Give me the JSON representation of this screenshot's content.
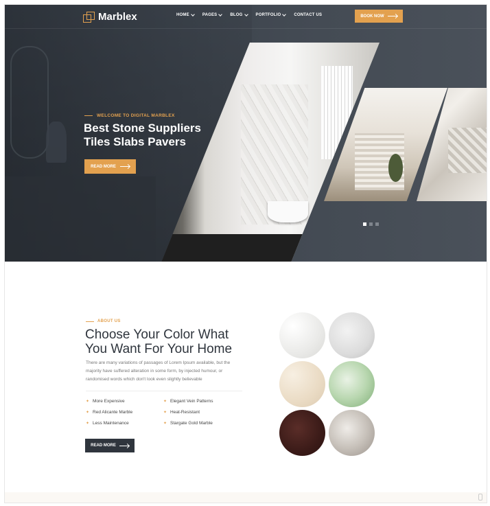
{
  "brand": {
    "name": "Marblex",
    "accent": "#e3a14f",
    "dark": "#2f353d"
  },
  "nav": {
    "items": [
      "HOME",
      "PAGES",
      "BLOG",
      "PORTFOLIO",
      "CONTACT US"
    ],
    "book_label": "BOOK NOW"
  },
  "hero": {
    "kicker": "WELCOME TO DIGITAL MARBLEX",
    "title_line1": "Best Stone Suppliers",
    "title_line2": "Tiles Slabs Pavers",
    "button_label": "READ MORE",
    "slider": {
      "count": 3,
      "active": 1
    }
  },
  "about": {
    "kicker": "ABOUT US",
    "title_line1": "Choose Your Color What",
    "title_line2": "You Want For Your Home",
    "text": "There are many variations of passages of Lorem Ipsum available, but the majority have suffered alteration in some form, by injected humour, or randomised words which don't look even slightly believable",
    "features": [
      "More Expensive",
      "Elegant Vein Patterns",
      "Red Alicante Marble",
      "Heat-Resistant",
      "Less Maintenance",
      "Stargate Gold Marble"
    ],
    "button_label": "READ MORE"
  },
  "icons": {
    "logo": "logo-icon",
    "arrow": "arrow-right-icon",
    "chevron": "chevron-down-icon",
    "feature": "star-icon"
  }
}
